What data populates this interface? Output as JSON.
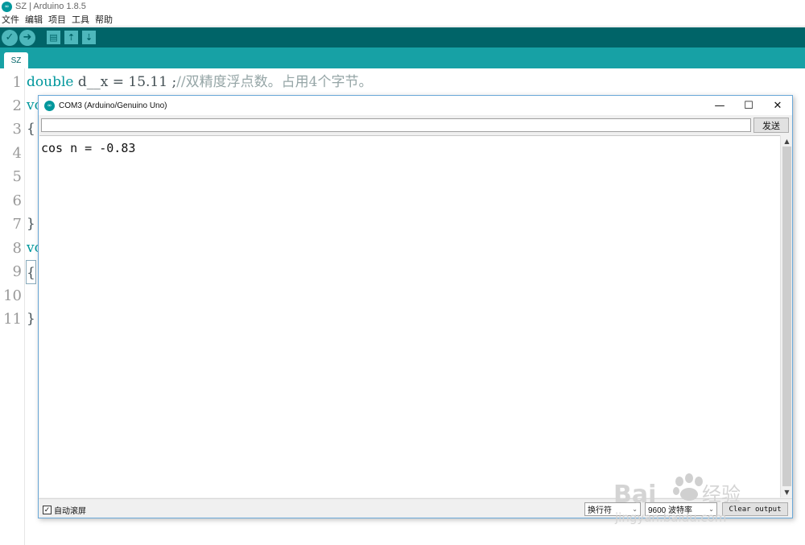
{
  "window": {
    "title": "SZ | Arduino 1.8.5",
    "logo_glyph": "∞"
  },
  "menu": [
    "文件",
    "编辑",
    "项目",
    "工具",
    "帮助"
  ],
  "toolbar": {
    "verify_glyph": "✓",
    "upload_glyph": "➜",
    "new_glyph": "▤",
    "open_glyph": "⇡",
    "save_glyph": "⇣"
  },
  "tab": {
    "label": "SZ"
  },
  "editor": {
    "line_numbers": [
      "1",
      "2",
      "3",
      "4",
      "5",
      "6",
      "7",
      "8",
      "9",
      "10",
      "11"
    ],
    "line1_kw": "double",
    "line1_code": " d__x = 15.11 ;",
    "line1_comment": "//双精度浮点数。占用4个字节。",
    "line2": "vo",
    "line3": "{",
    "line7": "}",
    "line8": "vo",
    "line9": "{",
    "line11": "}"
  },
  "serial_monitor": {
    "title": "COM3 (Arduino/Genuino Uno)",
    "minimize": "—",
    "maximize": "☐",
    "close": "✕",
    "input_value": "",
    "send_label": "发送",
    "output": "cos n = -0.83",
    "scroll_up": "▲",
    "scroll_down": "▼",
    "autoscroll_label": "自动滚屏",
    "autoscroll_checked": "✓",
    "line_ending": "换行符",
    "baud_rate": "9600 波特率",
    "caret": "⌄",
    "clear_label": "Clear output"
  },
  "colors": {
    "toolbar": "#006468",
    "tabbar": "#17a1a5",
    "keyword": "#00979c",
    "comment": "#95a5a6"
  },
  "watermark": {
    "text": "Bai",
    "text2": "经验",
    "url": "jingyan.baidu.com"
  }
}
